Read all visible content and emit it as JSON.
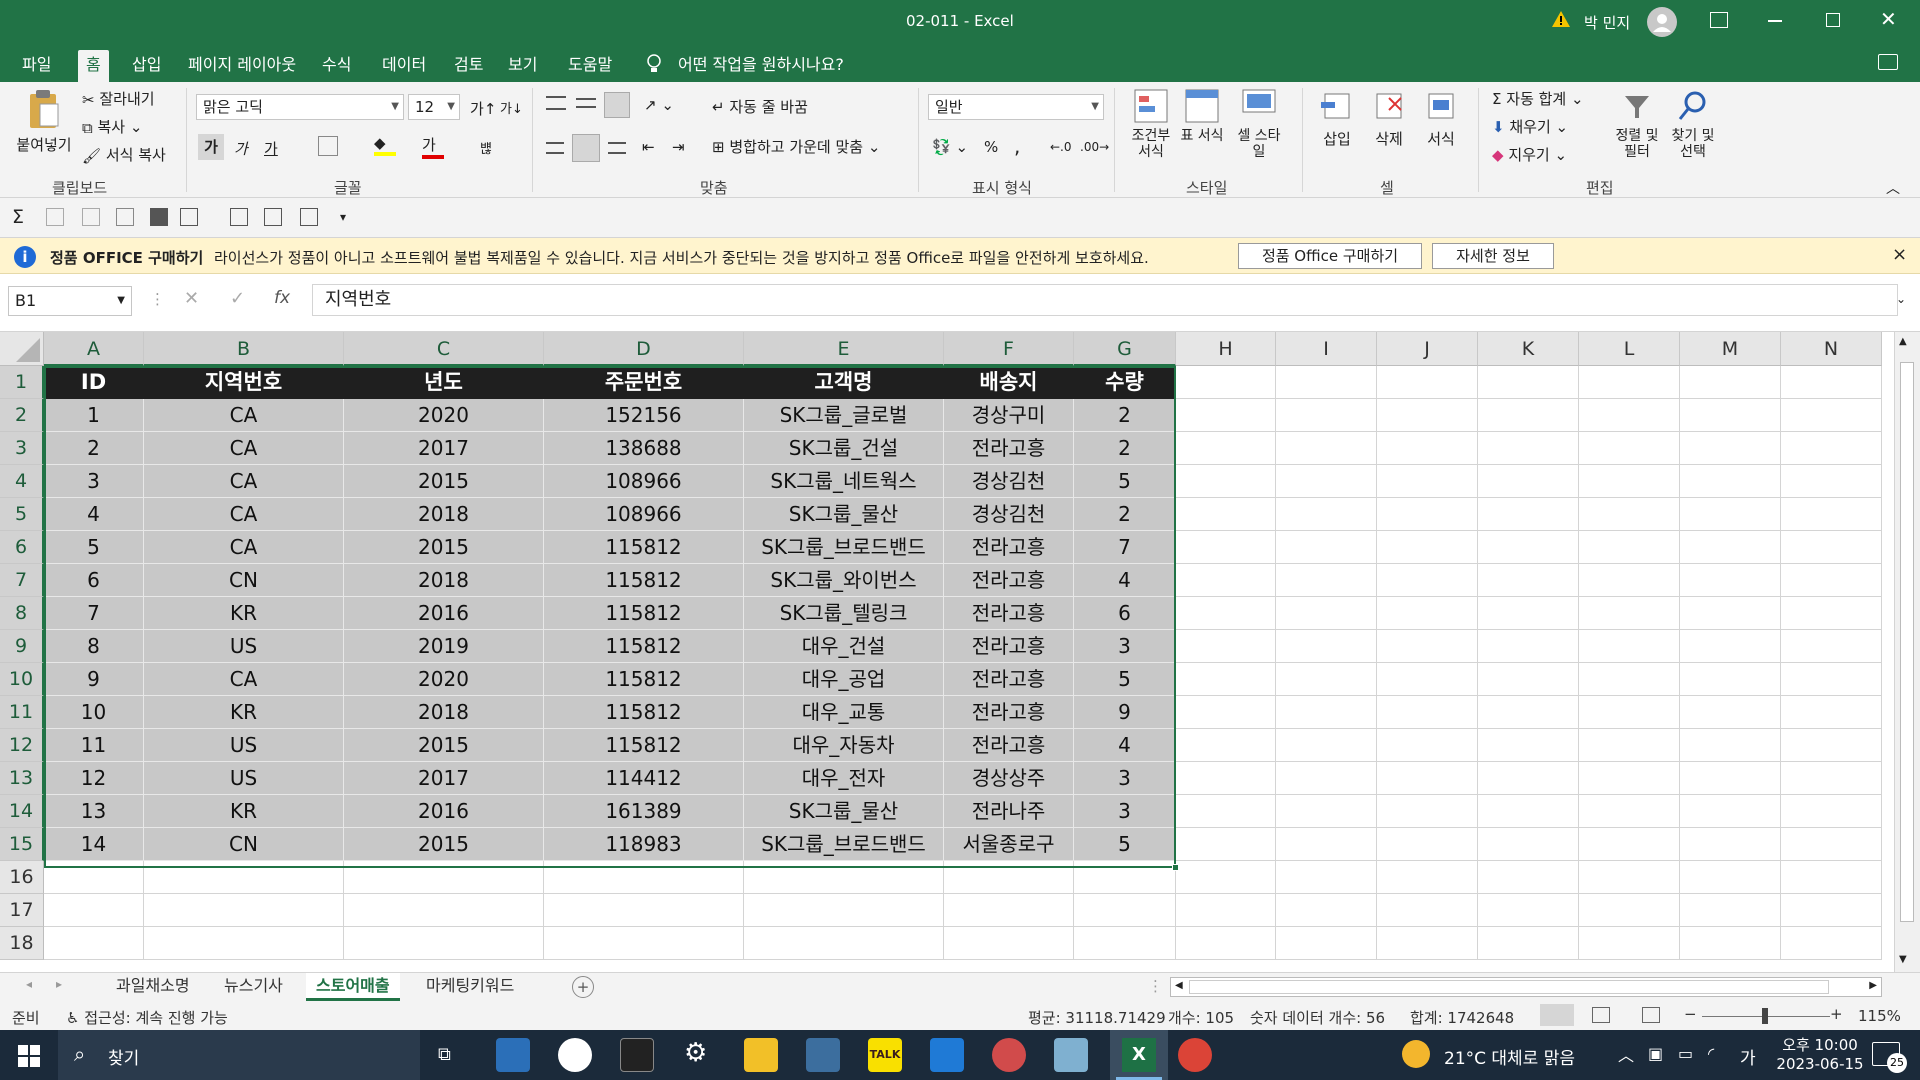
{
  "window": {
    "title": "02-011  -  Excel",
    "user": "박 민지",
    "controls": [
      "ribbon-display",
      "minimize",
      "maximize",
      "close"
    ]
  },
  "tabs": [
    {
      "label": "파일",
      "active": false
    },
    {
      "label": "홈",
      "active": true
    },
    {
      "label": "삽입",
      "active": false
    },
    {
      "label": "페이지 레이아웃",
      "active": false
    },
    {
      "label": "수식",
      "active": false
    },
    {
      "label": "데이터",
      "active": false
    },
    {
      "label": "검토",
      "active": false
    },
    {
      "label": "보기",
      "active": false
    },
    {
      "label": "도움말",
      "active": false
    }
  ],
  "tell_me": "어떤 작업을 원하시나요?",
  "ribbon": {
    "clipboard": {
      "label": "클립보드",
      "paste": "붙여넣기",
      "cut": "잘라내기",
      "copy": "복사",
      "format_painter": "서식 복사"
    },
    "font": {
      "label": "글꼴",
      "font_name": "맑은 고딕",
      "font_size": "12",
      "bold": "가",
      "italic": "가",
      "underline": "가",
      "grow": "가",
      "shrink": "가",
      "phonetic": "뱮"
    },
    "alignment": {
      "label": "맞춤",
      "wrap": "자동 줄 바꿈",
      "merge": "병합하고 가운데 맞춤"
    },
    "number": {
      "label": "표시 형식",
      "format": "일반",
      "percent": "%",
      "comma": ","
    },
    "styles": {
      "label": "스타일",
      "conditional": "조건부 서식",
      "table": "표 서식",
      "cell": "셀 스타일"
    },
    "cells": {
      "label": "셀",
      "insert": "삽입",
      "delete": "삭제",
      "format": "서식"
    },
    "editing": {
      "label": "편집",
      "autosum": "자동 합계",
      "fill": "채우기",
      "clear": "지우기",
      "sort": "정렬 및 필터",
      "find": "찾기 및 선택"
    }
  },
  "message_bar": {
    "title": "정품 OFFICE 구매하기",
    "text": "라이선스가 정품이 아니고 소프트웨어 불법 복제품일 수 있습니다. 지금 서비스가 중단되는 것을 방지하고 정품 Office로 파일을 안전하게 보호하세요.",
    "buy_button": "정품 Office 구매하기",
    "info_button": "자세한 정보",
    "close": "×"
  },
  "formula_bar": {
    "name_box": "B1",
    "fx": "fx",
    "value": "지역번호"
  },
  "grid": {
    "columns": [
      "A",
      "B",
      "C",
      "D",
      "E",
      "F",
      "G",
      "H",
      "I",
      "J",
      "K",
      "L",
      "M",
      "N"
    ],
    "selected_columns": [
      "A",
      "B",
      "C",
      "D",
      "E",
      "F",
      "G"
    ],
    "row_numbers": [
      "1",
      "2",
      "3",
      "4",
      "5",
      "6",
      "7",
      "8",
      "9",
      "10",
      "11",
      "12",
      "13",
      "14",
      "15",
      "16",
      "17",
      "18"
    ],
    "selected_rows": [
      "1",
      "2",
      "3",
      "4",
      "5",
      "6",
      "7",
      "8",
      "9",
      "10",
      "11",
      "12",
      "13",
      "14",
      "15"
    ],
    "header": [
      "ID",
      "지역번호",
      "년도",
      "주문번호",
      "고객명",
      "배송지",
      "수량"
    ],
    "rows": [
      [
        "1",
        "CA",
        "2020",
        "152156",
        "SK그룹_글로벌",
        "경상구미",
        "2"
      ],
      [
        "2",
        "CA",
        "2017",
        "138688",
        "SK그룹_건설",
        "전라고흥",
        "2"
      ],
      [
        "3",
        "CA",
        "2015",
        "108966",
        "SK그룹_네트웍스",
        "경상김천",
        "5"
      ],
      [
        "4",
        "CA",
        "2018",
        "108966",
        "SK그룹_물산",
        "경상김천",
        "2"
      ],
      [
        "5",
        "CA",
        "2015",
        "115812",
        "SK그룹_브로드밴드",
        "전라고흥",
        "7"
      ],
      [
        "6",
        "CN",
        "2018",
        "115812",
        "SK그룹_와이번스",
        "전라고흥",
        "4"
      ],
      [
        "7",
        "KR",
        "2016",
        "115812",
        "SK그룹_텔링크",
        "전라고흥",
        "6"
      ],
      [
        "8",
        "US",
        "2019",
        "115812",
        "대우_건설",
        "전라고흥",
        "3"
      ],
      [
        "9",
        "CA",
        "2020",
        "115812",
        "대우_공업",
        "전라고흥",
        "5"
      ],
      [
        "10",
        "KR",
        "2018",
        "115812",
        "대우_교통",
        "전라고흥",
        "9"
      ],
      [
        "11",
        "US",
        "2015",
        "115812",
        "대우_자동차",
        "전라고흥",
        "4"
      ],
      [
        "12",
        "US",
        "2017",
        "114412",
        "대우_전자",
        "경상상주",
        "3"
      ],
      [
        "13",
        "KR",
        "2016",
        "161389",
        "SK그룹_물산",
        "전라나주",
        "3"
      ],
      [
        "14",
        "CN",
        "2015",
        "118983",
        "SK그룹_브로드밴드",
        "서울종로구",
        "5"
      ]
    ]
  },
  "sheets": [
    {
      "label": "과일채소명",
      "active": false
    },
    {
      "label": "뉴스기사",
      "active": false
    },
    {
      "label": "스토어매출",
      "active": true
    },
    {
      "label": "마케팅키워드",
      "active": false
    }
  ],
  "status": {
    "ready": "준비",
    "accessibility": "접근성: 계속 진행 가능",
    "average": "평균: 31118.71429",
    "count": "개수: 105",
    "numeric_count": "숫자 데이터 개수: 56",
    "sum": "합계: 1742648",
    "zoom": "115%"
  },
  "taskbar": {
    "search": "찾기",
    "weather": "21°C  대체로 맑음",
    "ime": "가",
    "time": "오후 10:00",
    "date": "2023-06-15",
    "notifications": "25"
  },
  "colors": {
    "excel_green": "#217346",
    "header_fill": "#1f1f1f",
    "data_fill": "#c8c8c8",
    "message_bg": "#fff4ce"
  }
}
